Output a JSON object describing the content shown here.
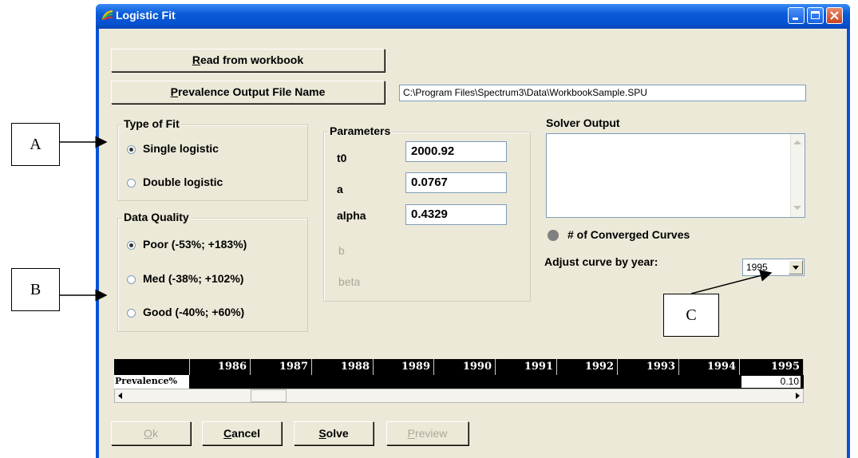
{
  "window": {
    "title": "Logistic Fit"
  },
  "buttons": {
    "read_workbook": {
      "prefix": "",
      "accel": "R",
      "rest": "ead from workbook"
    },
    "prevalence_file": {
      "prefix": "",
      "accel": "P",
      "rest": "revalence Output File Name"
    },
    "ok": {
      "accel": "O",
      "rest": "k"
    },
    "cancel": {
      "accel": "C",
      "rest": "ancel"
    },
    "solve": {
      "accel": "S",
      "rest": "olve"
    },
    "preview": {
      "accel": "P",
      "rest": "review"
    }
  },
  "file_path": "C:\\Program Files\\Spectrum3\\Data\\WorkbookSample.SPU",
  "type_of_fit": {
    "legend": "Type of Fit",
    "options": [
      "Single logistic",
      "Double logistic"
    ],
    "selected": "Single logistic"
  },
  "data_quality": {
    "legend": "Data Quality",
    "options": [
      "Poor (-53%; +183%)",
      "Med (-38%; +102%)",
      "Good (-40%; +60%)"
    ],
    "selected": "Poor (-53%; +183%)"
  },
  "parameters": {
    "legend": "Parameters",
    "items": [
      {
        "label": "t0",
        "value": "2000.92"
      },
      {
        "label": "a",
        "value": "0.0767"
      },
      {
        "label": "alpha",
        "value": "0.4329"
      },
      {
        "label": "b",
        "value": ""
      },
      {
        "label": "beta",
        "value": ""
      }
    ]
  },
  "solver": {
    "label": "Solver Output",
    "converged_label": "# of Converged Curves",
    "adjust_label": "Adjust curve by year:",
    "year_selected": "1995"
  },
  "grid": {
    "row_label": "Prevalence%",
    "years": [
      "1986",
      "1987",
      "1988",
      "1989",
      "1990",
      "1991",
      "1992",
      "1993",
      "1994",
      "1995"
    ],
    "values": [
      "",
      "",
      "",
      "",
      "",
      "",
      "",
      "",
      "",
      "0.10"
    ]
  },
  "callouts": {
    "a": "A",
    "b": "B",
    "c": "C"
  },
  "colors": {
    "titlebar": "#0a5bd8",
    "face": "#ece9d8",
    "disabled_text": "#aca899"
  }
}
